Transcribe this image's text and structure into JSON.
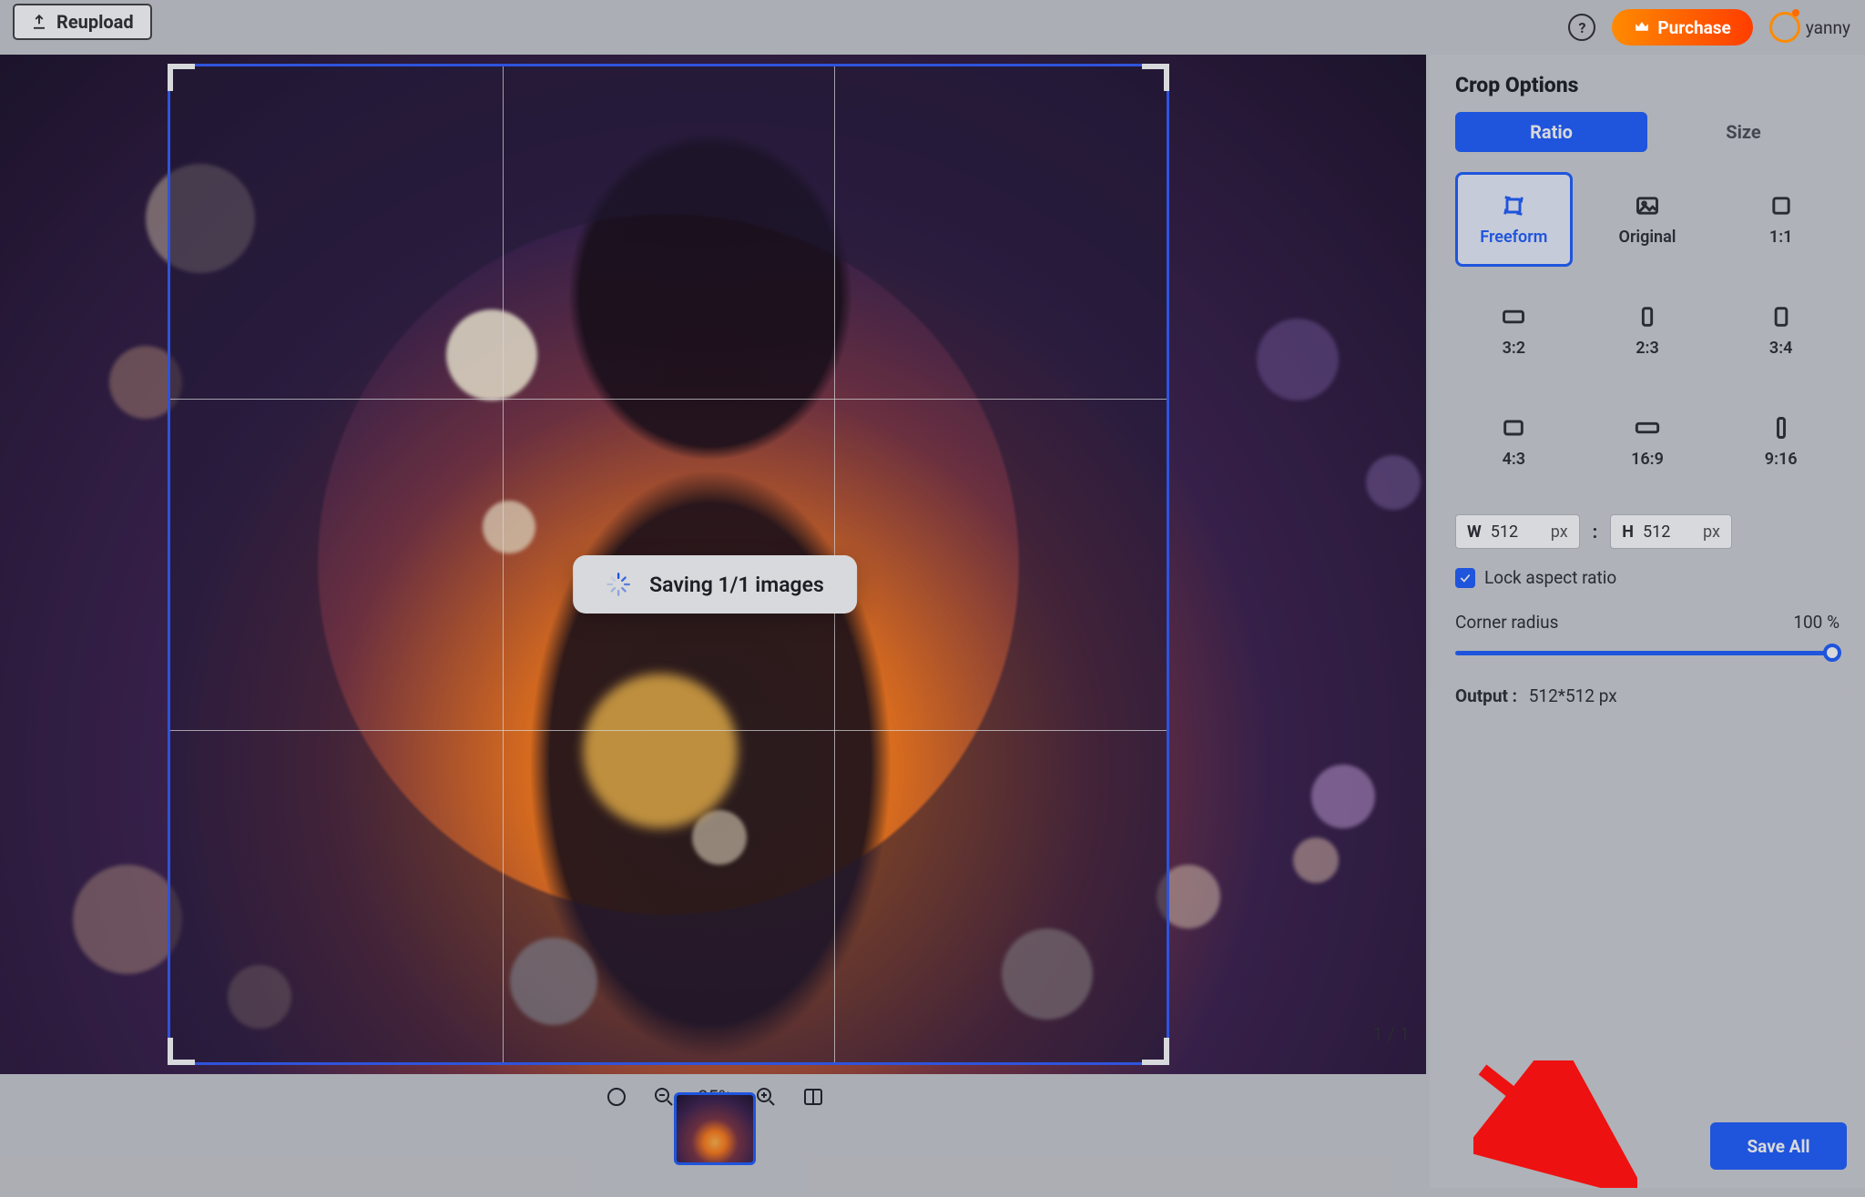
{
  "topbar": {
    "reupload_label": "Reupload",
    "help_icon": "?",
    "purchase_label": "Purchase",
    "username": "yanny"
  },
  "canvas": {
    "saving_label": "Saving 1/1 images",
    "zoom_label": "25%",
    "page_counter": "1 / 1"
  },
  "panel": {
    "title": "Crop Options",
    "tabs": {
      "ratio": "Ratio",
      "size": "Size"
    },
    "ratios": [
      {
        "key": "freeform",
        "label": "Freeform",
        "active": true
      },
      {
        "key": "original",
        "label": "Original"
      },
      {
        "key": "1_1",
        "label": "1:1"
      },
      {
        "key": "3_2",
        "label": "3:2"
      },
      {
        "key": "2_3",
        "label": "2:3"
      },
      {
        "key": "3_4",
        "label": "3:4"
      },
      {
        "key": "4_3",
        "label": "4:3"
      },
      {
        "key": "16_9",
        "label": "16:9"
      },
      {
        "key": "9_16",
        "label": "9:16"
      }
    ],
    "width": {
      "label": "W",
      "value": "512",
      "unit": "px"
    },
    "height": {
      "label": "H",
      "value": "512",
      "unit": "px"
    },
    "lock_label": "Lock aspect ratio",
    "corner_radius_label": "Corner radius",
    "corner_radius_value": "100 %",
    "output_label": "Output :",
    "output_value": "512*512 px",
    "save_all_label": "Save All"
  }
}
